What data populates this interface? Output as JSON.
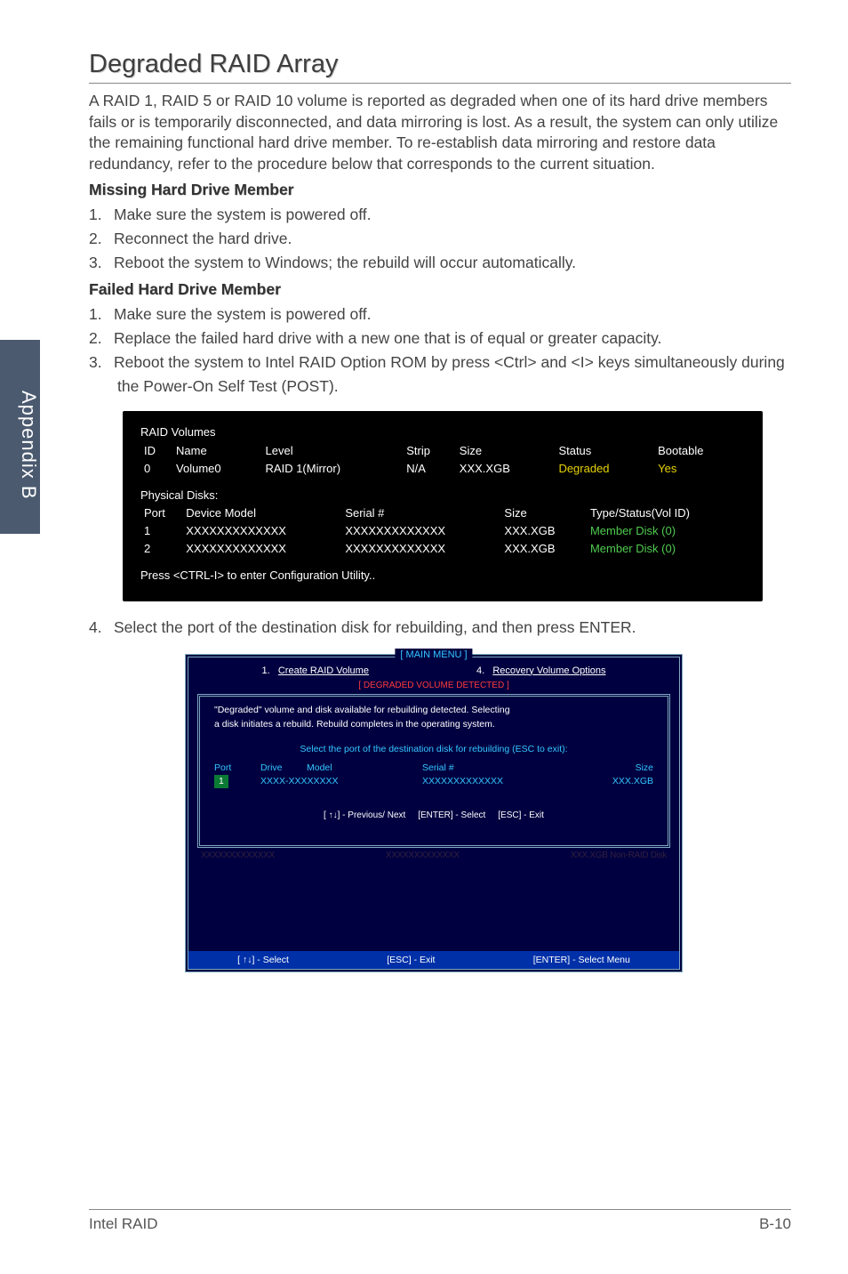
{
  "sidetab": "Appendix B",
  "heading": "Degraded RAID Array",
  "intro": "A RAID 1, RAID 5 or RAID 10 volume is reported as degraded when one of its hard drive members fails or is temporarily disconnected, and data mirroring is lost. As a result, the system can only utilize the remaining functional hard drive member. To re-establish data mirroring and restore data redundancy, refer to the procedure below that corresponds to the current situation.",
  "sub1": "Missing Hard Drive Member",
  "list1": {
    "i1": "Make sure the system is powered off.",
    "i2": "Reconnect the hard drive.",
    "i3": "Reboot the system to Windows; the rebuild will occur automatically."
  },
  "sub2": "Failed Hard Drive Member",
  "list2": {
    "i1": "Make sure the system is powered off.",
    "i2": "Replace the failed hard drive with a new one that is of equal or greater capacity.",
    "i3": "Reboot the system to Intel RAID Option ROM by press <Ctrl> and <I> keys simultaneously during the Power-On Self Test (POST)."
  },
  "bios1": {
    "sect1": "RAID Volumes",
    "h": {
      "c1": "ID",
      "c2": "Name",
      "c3": "Level",
      "c4": "Strip",
      "c5": "Size",
      "c6": "Status",
      "c7": "Bootable"
    },
    "r": {
      "c1": "0",
      "c2": "Volume0",
      "c3": "RAID 1(Mirror)",
      "c4": "N/A",
      "c5": "XXX.XGB",
      "c6": "Degraded",
      "c7": "Yes"
    },
    "sect2": "Physical Disks:",
    "ph": {
      "c1": "Port",
      "c2": "Device Model",
      "c3": "Serial #",
      "c4": "Size",
      "c5": "Type/Status(Vol ID)"
    },
    "p1": {
      "c1": "1",
      "c2": "XXXXXXXXXXXXX",
      "c3": "XXXXXXXXXXXXX",
      "c4": "XXX.XGB",
      "c5": "Member Disk (0)"
    },
    "p2": {
      "c1": "2",
      "c2": "XXXXXXXXXXXXX",
      "c3": "XXXXXXXXXXXXX",
      "c4": "XXX.XGB",
      "c5": "Member Disk (0)"
    },
    "prompt": "Press  <CTRL-I>  to enter Configuration Utility.."
  },
  "step4": "Select the port of the destination disk for rebuilding, and then press ENTER.",
  "bios2": {
    "title": "[   MAIN  MENU   ]",
    "menu": {
      "m1n": "1.",
      "m1": "Create  RAID  Volume",
      "m4n": "4.",
      "m4": "Recovery  Volume  Options"
    },
    "redlabel": "[  DEGRADED VOLUME DETECTED  ]",
    "msg1": "\"Degraded\" volume and disk available for rebuilding detected. Selecting",
    "msg2": "a disk initiates a rebuild. Rebuild completes in the  operating system.",
    "msg3": "Select the port of the destination disk for rebuilding (ESC to exit):",
    "hdr": {
      "c1": "Port",
      "c2": "Drive",
      "c3": "Model",
      "c4": "Serial  #",
      "c5": "Size"
    },
    "row": {
      "c1": "1",
      "c2": "XXXX-XXXXXXXX",
      "c4": "XXXXXXXXXXXXX",
      "c5": "XXX.XGB"
    },
    "nav": {
      "a": "[ ↑↓] - Previous/ Next",
      "b": "[ENTER] - Select",
      "c": "[ESC] - Exit"
    },
    "ghost": {
      "a": " XXXXXXXXXXXXX",
      "b": " XXXXXXXXXXXXX",
      "c": "XXX.XGB   Non-RAID  Disk"
    },
    "footer": {
      "a": "[ ↑↓] - Select",
      "b": "[ESC] - Exit",
      "c": "[ENTER] - Select Menu"
    }
  },
  "footer": {
    "left": "Intel RAID",
    "right": "B-10"
  }
}
